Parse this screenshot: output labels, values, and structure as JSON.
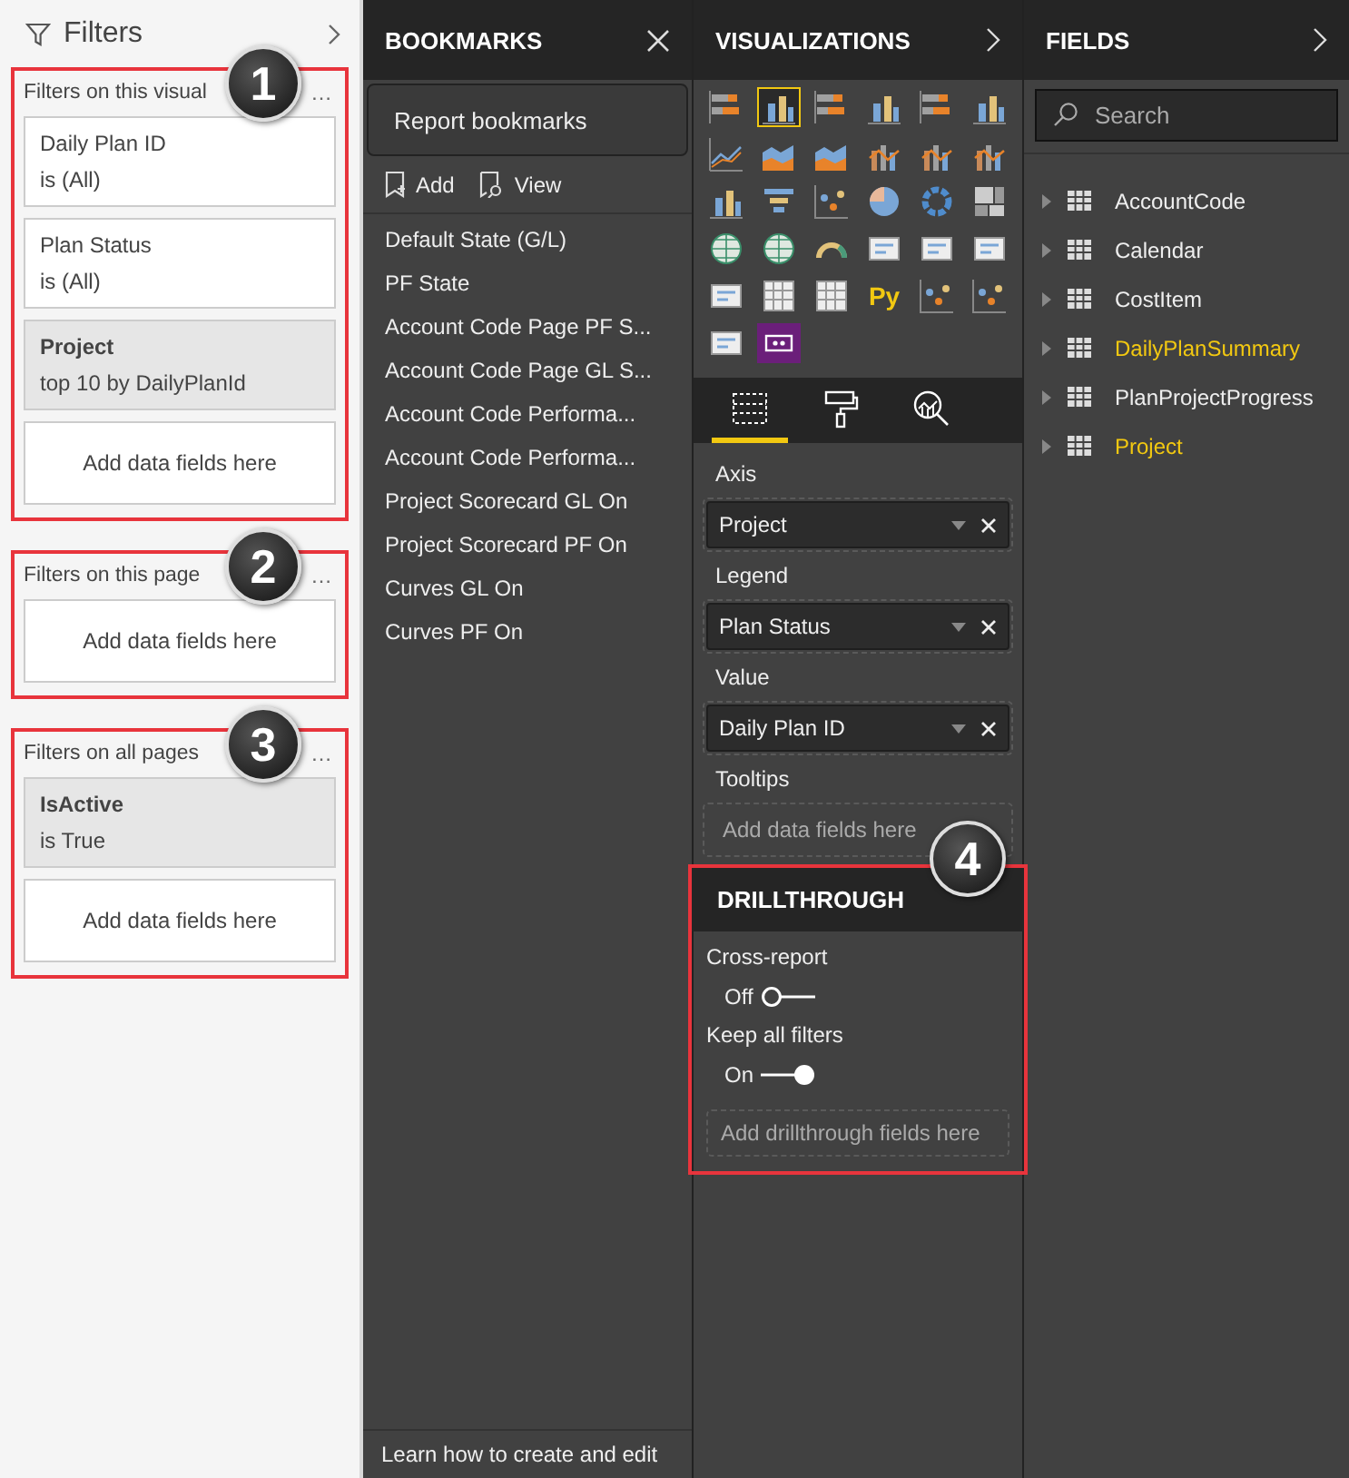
{
  "filters": {
    "title": "Filters",
    "sections": [
      {
        "title": "Filters on this visual",
        "more": "…",
        "highlighted": true,
        "callout": "1",
        "cards": [
          {
            "kind": "filter",
            "name": "Daily Plan ID",
            "condition": "is (All)",
            "applied": false
          },
          {
            "kind": "filter",
            "name": "Plan Status",
            "condition": "is (All)",
            "applied": false
          },
          {
            "kind": "filter",
            "name": "Project",
            "condition": "top 10 by DailyPlanId",
            "applied": true
          },
          {
            "kind": "dropzone",
            "text": "Add data fields here"
          }
        ]
      },
      {
        "title": "Filters on this page",
        "more": "…",
        "highlighted": true,
        "callout": "2",
        "cards": [
          {
            "kind": "dropzone",
            "text": "Add data fields here"
          }
        ]
      },
      {
        "title": "Filters on all pages",
        "more": "…",
        "highlighted": true,
        "callout": "3",
        "cards": [
          {
            "kind": "filter",
            "name": "IsActive",
            "condition": "is True",
            "applied": true
          },
          {
            "kind": "dropzone",
            "text": "Add data fields here"
          }
        ]
      }
    ]
  },
  "bookmarks": {
    "title": "BOOKMARKS",
    "report_button": "Report bookmarks",
    "actions": [
      {
        "kind": "add",
        "label": "Add"
      },
      {
        "kind": "view",
        "label": "View"
      }
    ],
    "items": [
      "Default State (G/L)",
      "PF State",
      "Account Code Page PF S...",
      "Account Code Page GL S...",
      "Account Code Performa...",
      "Account Code Performa...",
      "Project Scorecard GL On",
      "Project Scorecard PF On",
      "Curves GL On",
      "Curves PF On"
    ],
    "footer": "Learn how to create and edit"
  },
  "visualizations": {
    "title": "VISUALIZATIONS",
    "visual_types": [
      {
        "kind": "hbar",
        "selected": false
      },
      {
        "kind": "column",
        "selected": true
      },
      {
        "kind": "hbar",
        "selected": false
      },
      {
        "kind": "column",
        "selected": false
      },
      {
        "kind": "hbar",
        "selected": false
      },
      {
        "kind": "column",
        "selected": false
      },
      {
        "kind": "line",
        "selected": false
      },
      {
        "kind": "area",
        "selected": false
      },
      {
        "kind": "area",
        "selected": false
      },
      {
        "kind": "combo",
        "selected": false
      },
      {
        "kind": "combo",
        "selected": false
      },
      {
        "kind": "combo",
        "selected": false
      },
      {
        "kind": "column",
        "selected": false
      },
      {
        "kind": "funnel",
        "selected": false
      },
      {
        "kind": "scatter",
        "selected": false
      },
      {
        "kind": "pie",
        "selected": false
      },
      {
        "kind": "donut",
        "selected": false
      },
      {
        "kind": "treemap",
        "selected": false
      },
      {
        "kind": "map",
        "selected": false
      },
      {
        "kind": "map",
        "selected": false
      },
      {
        "kind": "gauge",
        "selected": false
      },
      {
        "kind": "card",
        "selected": false
      },
      {
        "kind": "card",
        "selected": false
      },
      {
        "kind": "card",
        "selected": false
      },
      {
        "kind": "card",
        "selected": false
      },
      {
        "kind": "table",
        "selected": false
      },
      {
        "kind": "table",
        "selected": false
      },
      {
        "kind": "script",
        "label": "Py",
        "selected": false
      },
      {
        "kind": "scatter",
        "selected": false
      },
      {
        "kind": "scatter",
        "selected": false
      },
      {
        "kind": "card",
        "selected": false
      },
      {
        "kind": "custom",
        "selected": false
      }
    ],
    "build_tabs": [
      {
        "kind": "fields",
        "selected": true
      },
      {
        "kind": "format",
        "selected": false
      },
      {
        "kind": "analytics",
        "selected": false
      }
    ],
    "wells": [
      {
        "label": "Axis",
        "field": "Project"
      },
      {
        "label": "Legend",
        "field": "Plan Status"
      },
      {
        "label": "Value",
        "field": "Daily Plan ID"
      },
      {
        "label": "Tooltips",
        "placeholder": "Add data fields here"
      }
    ],
    "drillthrough": {
      "title": "DRILLTHROUGH",
      "highlighted": true,
      "callout": "4",
      "toggles": [
        {
          "label": "Cross-report",
          "state": "Off",
          "on": false
        },
        {
          "label": "Keep all filters",
          "state": "On",
          "on": true
        }
      ],
      "placeholder": "Add drillthrough fields here"
    }
  },
  "fields": {
    "title": "FIELDS",
    "search": {
      "placeholder": "Search"
    },
    "tables": [
      {
        "name": "AccountCode",
        "used": false
      },
      {
        "name": "Calendar",
        "used": false
      },
      {
        "name": "CostItem",
        "used": false
      },
      {
        "name": "DailyPlanSummary",
        "used": true
      },
      {
        "name": "PlanProjectProgress",
        "used": false
      },
      {
        "name": "Project",
        "used": true
      }
    ]
  }
}
